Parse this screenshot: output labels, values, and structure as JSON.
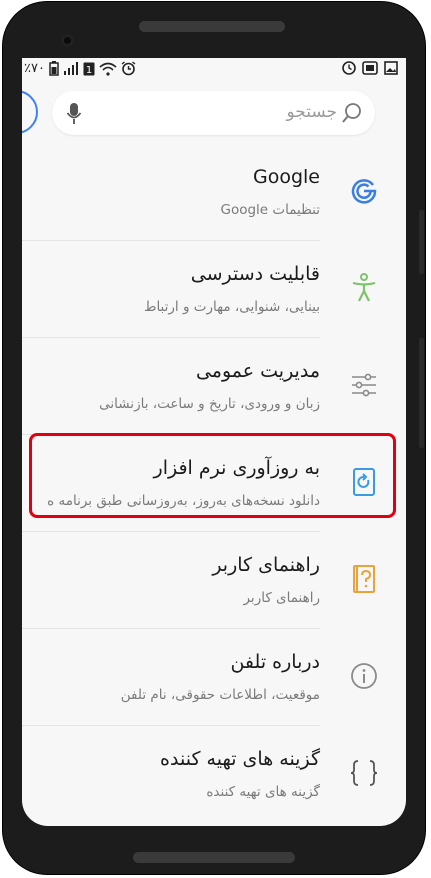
{
  "statusbar": {
    "battery": "٪۷۰"
  },
  "search": {
    "placeholder": "جستجو"
  },
  "settings": [
    {
      "title": "Google",
      "subtitle": "تنظیمات Google"
    },
    {
      "title": "قابلیت دسترسی",
      "subtitle": "بینایی، شنوایی، مهارت و ارتباط"
    },
    {
      "title": "مدیریت عمومی",
      "subtitle": "زبان و ورودی، تاریخ و ساعت، بازنشانی"
    },
    {
      "title": "به روزآوری نرم افزار",
      "subtitle": "دانلود نسخه‌های به‌روز، به‌روزسانی طبق برنامه ه"
    },
    {
      "title": "راهنمای کاربر",
      "subtitle": "راهنمای کاربر"
    },
    {
      "title": "درباره تلفن",
      "subtitle": "موقعیت، اطلاعات حقوقی، نام تلفن"
    },
    {
      "title": "گزینه های تهیه کننده",
      "subtitle": "گزینه های تهیه کننده"
    }
  ],
  "colors": {
    "highlight": "#e0000f",
    "google_blue": "#3b7de0",
    "accessibility_green": "#7cc36b",
    "update_blue": "#3b9ae0",
    "guide_orange": "#e8a43a"
  }
}
